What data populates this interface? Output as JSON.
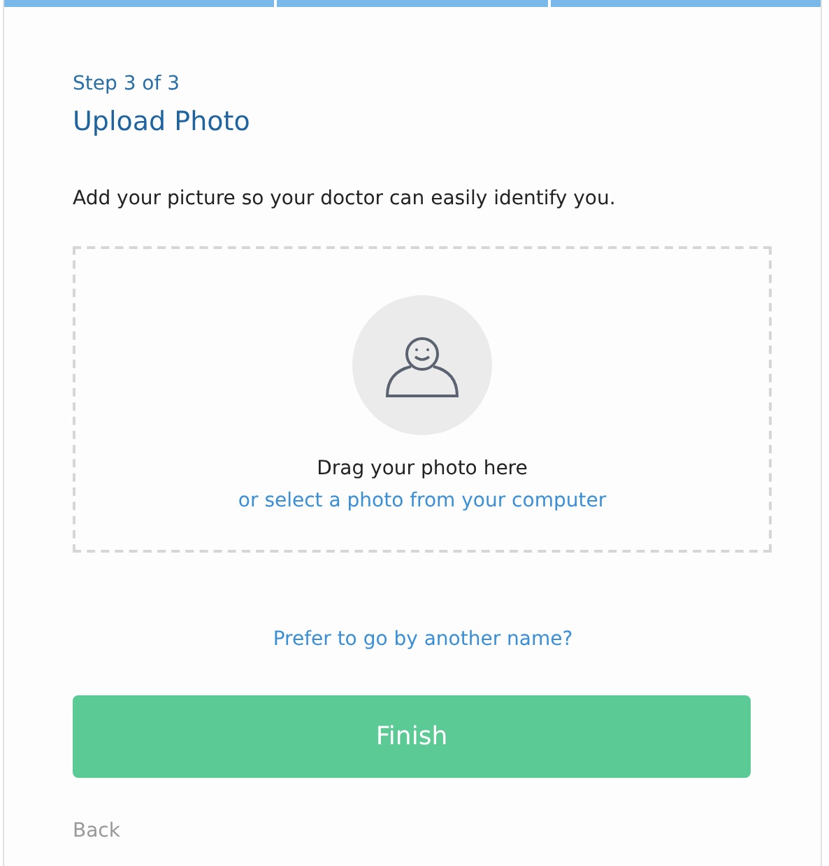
{
  "progress": [
    {
      "complete": true
    },
    {
      "complete": true
    },
    {
      "complete": true
    }
  ],
  "step": "Step 3 of 3",
  "title": "Upload Photo",
  "description": "Add your picture so your doctor can easily identify you.",
  "dropzone": {
    "instruction": "Drag your photo here",
    "link": "or select a photo from your computer"
  },
  "alternate_name_link": "Prefer to go by another name?",
  "finish_button": "Finish",
  "back_link": "Back"
}
